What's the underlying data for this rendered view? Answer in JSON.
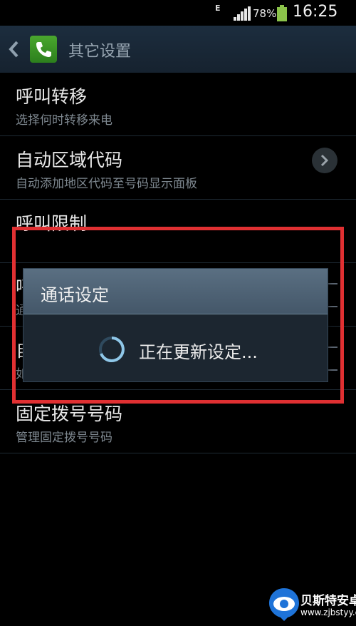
{
  "status_bar": {
    "network": "E",
    "battery": "78%",
    "time": "16:25"
  },
  "action_bar": {
    "title": "其它设置"
  },
  "list": [
    {
      "title": "呼叫转移",
      "subtitle": "选择何时转移来电"
    },
    {
      "title": "自动区域代码",
      "subtitle": "自动添加地区代码至号码显示面板"
    },
    {
      "title": "呼叫限制",
      "subtitle": ""
    },
    {
      "title": "呼",
      "subtitle": "通"
    },
    {
      "title": "自",
      "subtitle": "如"
    },
    {
      "title": "固定拨号号码",
      "subtitle": "管理固定拨号号码"
    }
  ],
  "dialog": {
    "title": "通话设定",
    "message": "正在更新设定..."
  },
  "colors": {
    "annotation": "#e03032",
    "action_bar": "#1c2d3e",
    "dialog_header": "#4f6376"
  },
  "watermark": {
    "name": "贝斯特安卓网",
    "url": "www.zjbstyy.com"
  }
}
